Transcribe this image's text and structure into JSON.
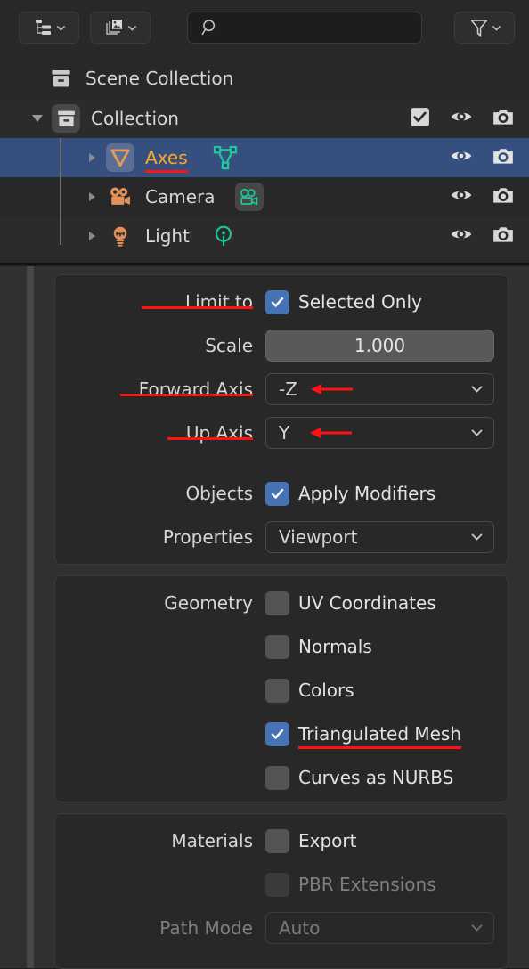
{
  "outliner": {
    "header": {
      "display_mode_button": {
        "icon": "outliner-display-mode-icon",
        "chevron": "chevron-down-icon"
      },
      "filter_id_button": {
        "icon": "image-stack-icon",
        "chevron": "chevron-down-icon"
      },
      "search": {
        "icon": "search-icon",
        "value": "",
        "placeholder": ""
      },
      "filter_button": {
        "icon": "funnel-filter-icon",
        "chevron": "chevron-down-icon"
      }
    },
    "rows": [
      {
        "name": "Scene Collection",
        "icon": "scene-collection-icon",
        "indent": 0,
        "disclosure": "none",
        "selected": false,
        "highlighted": false,
        "toggles": []
      },
      {
        "name": "Collection",
        "icon": "collection-icon",
        "indent": 1,
        "disclosure": "open",
        "selected": false,
        "highlighted": false,
        "toggles": [
          "checkbox-checked",
          "eye-icon",
          "camera-icon"
        ]
      },
      {
        "name": "Axes",
        "icon": "empty-plain-axes-icon",
        "data_icon": "mesh-data-icon",
        "indent": 2,
        "disclosure": "closed",
        "selected": true,
        "highlighted": true,
        "annotated": true,
        "toggles": [
          "eye-icon",
          "camera-icon"
        ]
      },
      {
        "name": "Camera",
        "icon": "camera-object-icon",
        "data_icon": "camera-data-icon",
        "indent": 2,
        "disclosure": "closed",
        "selected": false,
        "highlighted": false,
        "toggles": [
          "eye-icon",
          "camera-icon"
        ]
      },
      {
        "name": "Light",
        "icon": "light-object-icon",
        "data_icon": "light-data-icon",
        "indent": 2,
        "disclosure": "closed",
        "selected": false,
        "highlighted": false,
        "toggles": [
          "eye-icon",
          "camera-icon"
        ]
      }
    ]
  },
  "properties": {
    "transform": {
      "limit_to_label": "Limit to",
      "selected_only_label": "Selected Only",
      "selected_only_checked": true,
      "scale_label": "Scale",
      "scale_value": "1.000",
      "forward_axis_label": "Forward Axis",
      "forward_axis_value": "-Z",
      "up_axis_label": "Up Axis",
      "up_axis_value": "Y",
      "objects_label": "Objects",
      "apply_modifiers_label": "Apply Modifiers",
      "apply_modifiers_checked": true,
      "properties_label": "Properties",
      "properties_value": "Viewport"
    },
    "geometry": {
      "section_label": "Geometry",
      "items": [
        {
          "label": "UV Coordinates",
          "checked": false,
          "annotated": false
        },
        {
          "label": "Normals",
          "checked": false,
          "annotated": false
        },
        {
          "label": "Colors",
          "checked": false,
          "annotated": false
        },
        {
          "label": "Triangulated Mesh",
          "checked": true,
          "annotated": true
        },
        {
          "label": "Curves as NURBS",
          "checked": false,
          "annotated": false
        }
      ]
    },
    "materials": {
      "section_label": "Materials",
      "export_label": "Export",
      "export_checked": false,
      "pbr_label": "PBR Extensions",
      "pbr_checked": false,
      "pbr_disabled": true,
      "path_mode_label": "Path Mode",
      "path_mode_value": "Auto",
      "path_mode_disabled": true
    }
  },
  "colors": {
    "accent_blue": "#4772b3",
    "selection_blue": "#35507f",
    "annotation_red": "#ff1212",
    "object_orange": "#e0915a",
    "data_green": "#1fc69a",
    "highlight_text": "#ffa724"
  }
}
